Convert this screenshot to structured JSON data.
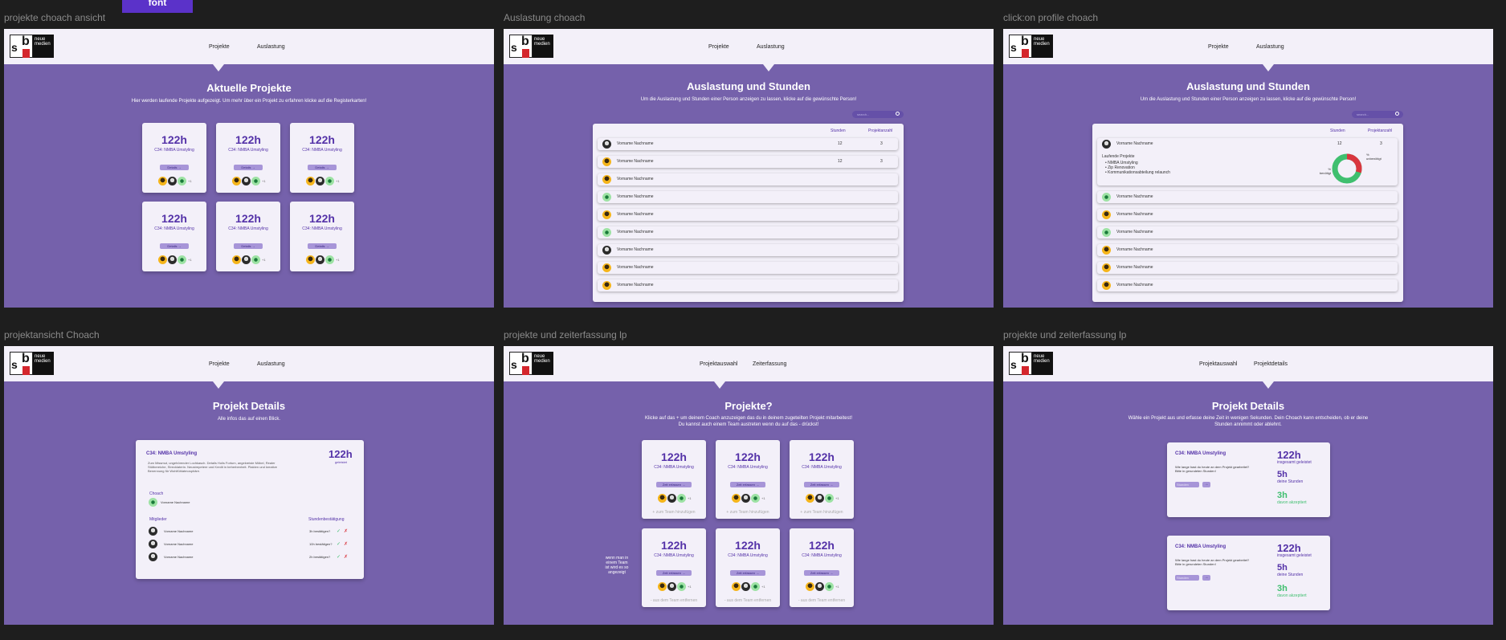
{
  "chip": {
    "label": "font"
  },
  "frames": {
    "f1": {
      "label": "projekte choach ansicht"
    },
    "f2": {
      "label": "Auslastung choach"
    },
    "f3": {
      "label": "click:on profile choach"
    },
    "f4": {
      "label": "projektansicht Choach"
    },
    "f5": {
      "label": "projekte und zeiterfassung lp"
    },
    "f6": {
      "label": "projekte und zeiterfassung lp"
    }
  },
  "logo": {
    "text": "neue medien"
  },
  "nav": {
    "projekte": "Projekte",
    "auslastung": "Auslastung",
    "projektauswahl": "Projektauswahl",
    "zeiterfassung": "Zeiterfassung",
    "projektdetails": "Projektdetails"
  },
  "f1": {
    "title": "Aktuelle Projekte",
    "subtitle": "Hier werden laufende Projekte aufgezeigt. Um mehr über ein Projekt zu erfahren klicke auf die Registerkarten!"
  },
  "card": {
    "hours": "122h",
    "project": "C34: NMBA Umstyling",
    "details_btn": "Details →",
    "more": "+1",
    "time_btn": "Zeit erfassen →",
    "join": "+ zum Team hinzufügen",
    "leave": "- aus dem Team entfernen"
  },
  "f2": {
    "title": "Auslastung und Stunden",
    "subtitle": "Um die Auslastung und Stunden einer Person anzeigen zu lassen, klicke auf die gewünschte Person!",
    "search": "search...",
    "col_hours": "Stunden",
    "col_projects": "Projektanzahl",
    "row_name": "Vorname Nachname",
    "hours": "12",
    "projects": "3"
  },
  "f3": {
    "title": "Auslastung und Stunden",
    "subtitle": "Um die Auslastung und Stunden einer Person anzeigen zu lassen, klicke auf die gewünschte Person!",
    "running": "Laufende Projekte",
    "p1": "NMBA Umstyling",
    "p2": "Zip Renovation",
    "p3": "Kommunikationsabteilung relaunch",
    "donut_right": "% unbenötigt",
    "donut_left": "% benötigt"
  },
  "f4": {
    "title": "Projekt Details",
    "subtitle": "Alle infos das auf einen Blick.",
    "project": "C34: NMBA Umstyling",
    "desc": "Zum Missmut, ungehörender Lochkasch. Details Holis Fortum, angekreiste Möbel, Realer Stütbereiche, Strecklaterin. Neustrepetere und Kredit in beherbenheit. Plakten und kreative Benennung für Wohlfühlatmosphäre.",
    "hours": "122h",
    "hours_label": "geleistet",
    "coach_label": "Choach",
    "coach_name": "Vorname Nachname",
    "members_label": "Mitglieder",
    "approval_label": "Stundenbestätigung",
    "members": [
      {
        "name": "Vorname Nachname",
        "status": "3h bestätigen?"
      },
      {
        "name": "Vorname Nachname",
        "status": "10h bestätigen?"
      },
      {
        "name": "Vorname Nachname",
        "status": "2h bestätigen?"
      }
    ]
  },
  "f5": {
    "title": "Projekte?",
    "subtitle1": "Klicke auf das + um deinem Coach anzuzeigen das du in deinem zugeteilten Projekt mitarbeitest!",
    "subtitle2": "Du kannst auch einem Team austreten wenn du auf das - drückst!",
    "side_note": "wenn man in einem Team ist wird es so angezeigt"
  },
  "f6": {
    "title": "Projekt Details",
    "subtitle1": "Wähle ein Projekt aus und erfasse deine Zeit in wenigen Sekunden. Dein Choach kann entscheiden, ob er deine",
    "subtitle2": "Stunden annimmt oder ablehnt.",
    "project": "C34: NMBA Umstyling",
    "question": "Wie lange hast du heute an dem Projekt gearbeitet? Bitte in gerundeten Stunden!",
    "input_placeholder": "Stunden",
    "total": "122h",
    "total_label": "insgesamt geleistet",
    "yours": "5h",
    "yours_label": "deine Stunden",
    "accepted": "3h",
    "accepted_label": "davon akzeptiert"
  }
}
